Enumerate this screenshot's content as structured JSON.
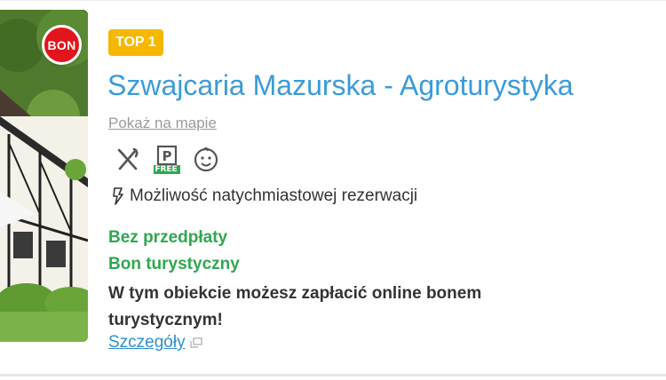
{
  "listing": {
    "top_badge": "TOP 1",
    "bon_badge": "BON",
    "title": "Szwajcaria Mazurska - Agroturystyka",
    "map_link": "Pokaż na mapie",
    "amenities": [
      {
        "icon": "restaurant-icon"
      },
      {
        "icon": "parking-icon",
        "label": "FREE"
      },
      {
        "icon": "kids-icon"
      }
    ],
    "instant_booking": "Możliwość natychmiastowej rezerwacji",
    "no_prepayment": "Bez przedpłaty",
    "tourist_voucher": "Bon turystyczny",
    "voucher_description": "W tym obiekcie możesz zapłacić online bonem turystycznym!",
    "details_link": "Szczegóły"
  },
  "colors": {
    "title": "#3a9bd9",
    "badge": "#f5b701",
    "green": "#2fa84f",
    "bon": "#e3141b",
    "link": "#2f8fd0"
  }
}
